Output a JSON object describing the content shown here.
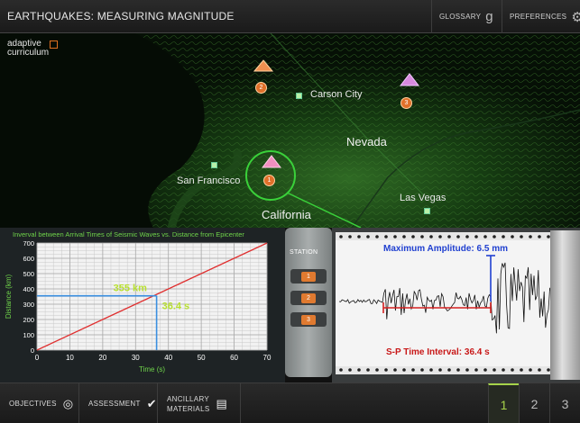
{
  "app": {
    "title": "EARTHQUAKES: MEASURING MAGNITUDE",
    "glossary_label": "GLOSSARY",
    "preferences_label": "PREFERENCES"
  },
  "logo": {
    "line1": "adaptive",
    "line2": "curriculum"
  },
  "map": {
    "cities": [
      "Carson City",
      "San Francisco",
      "Las Vegas"
    ],
    "states": [
      "Nevada",
      "California"
    ],
    "epicenters": [
      "1",
      "2",
      "3"
    ]
  },
  "chart": {
    "title": "Inverval between Arrival Times of Seismic Waves vs. Distance from Epicenter",
    "distance_annotation": "355 km",
    "time_annotation": "36.4 s"
  },
  "chart_data": {
    "type": "line",
    "title": "Inverval between Arrival Times of Seismic Waves vs. Distance from Epicenter",
    "xlabel": "Time (s)",
    "ylabel": "Distance (km)",
    "x": [
      0,
      70
    ],
    "y": [
      0,
      700
    ],
    "xticks": [
      0,
      10,
      20,
      30,
      40,
      50,
      60,
      70
    ],
    "yticks": [
      0,
      100,
      200,
      300,
      400,
      500,
      600,
      700
    ],
    "xlim": [
      0,
      70
    ],
    "ylim": [
      0,
      700
    ],
    "grid": true,
    "highlight": {
      "x": 36.4,
      "y": 355
    }
  },
  "station": {
    "label": "STATION",
    "buttons": [
      "1",
      "2",
      "3"
    ]
  },
  "seismogram": {
    "max_amplitude_label": "Maximum Amplitude: 6.5 mm",
    "sp_interval_label": "S-P Time Interval: 36.4 s"
  },
  "bottom": {
    "objectives_label": "OBJECTIVES",
    "assessment_label": "ASSESSMENT",
    "ancillary_line1": "ANCILLARY",
    "ancillary_line2": "MATERIALS",
    "pages": [
      "1",
      "2",
      "3"
    ],
    "active_page": "1"
  },
  "colors": {
    "chart_line": "#e03030",
    "highlight": "#3a8fe0",
    "annotation": "#b8e030",
    "amplitude": "#2040d0",
    "sp_interval": "#c81818"
  }
}
